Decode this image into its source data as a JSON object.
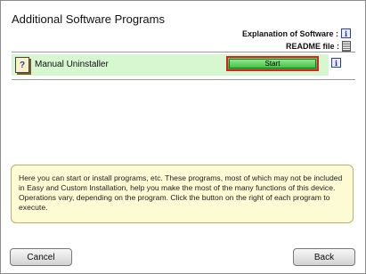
{
  "window": {
    "title": "Additional Software Programs"
  },
  "legend": {
    "explanation_label": "Explanation of Software :",
    "readme_label": "README file :"
  },
  "programs": [
    {
      "name": "Manual Uninstaller",
      "start_label": "Start"
    }
  ],
  "description": "Here you can start or install programs, etc. These programs, most of which may not be included in Easy and Custom Installation, help you make the most of the many functions of this device. Operations vary, depending on the program. Click the button on the right of each program to execute.",
  "footer": {
    "cancel_label": "Cancel",
    "back_label": "Back"
  },
  "icons": {
    "info": "info-icon",
    "readme": "readme-icon",
    "program": "program-help-icon"
  },
  "colors": {
    "row_bg": "#d6f7d0",
    "start_border": "#e02020",
    "start_green": "#45c24a",
    "desc_bg": "#fcfbd4"
  }
}
